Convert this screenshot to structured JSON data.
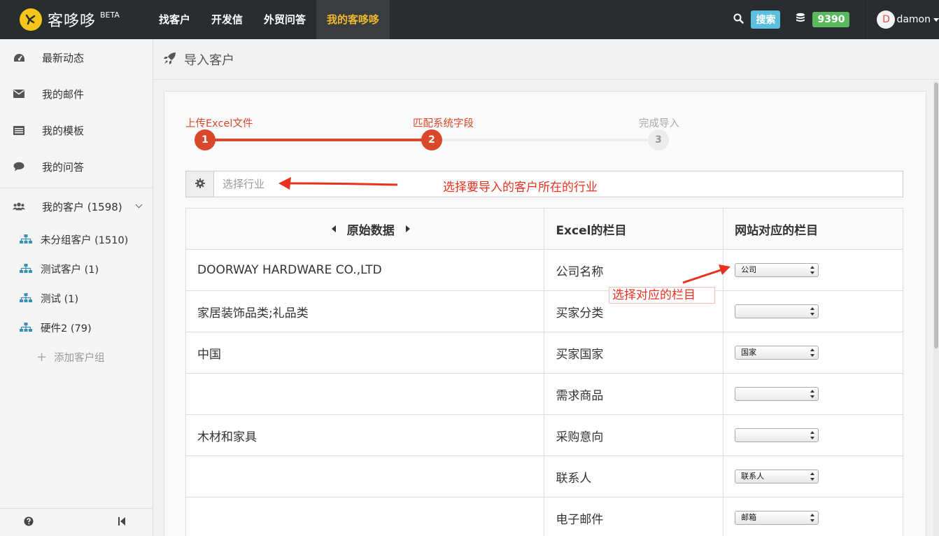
{
  "brand": {
    "name": "客哆哆",
    "beta": "BETA"
  },
  "nav": [
    {
      "label": "找客户"
    },
    {
      "label": "开发信"
    },
    {
      "label": "外贸问答"
    },
    {
      "label": "我的客哆哆",
      "active": true
    }
  ],
  "topright": {
    "search_label": "搜索",
    "credits": "9390",
    "avatar_letter": "D",
    "username": "damon"
  },
  "sidebar": {
    "items": [
      {
        "label": "最新动态",
        "icon": "dashboard-icon"
      },
      {
        "label": "我的邮件",
        "icon": "envelope-icon"
      },
      {
        "label": "我的模板",
        "icon": "list-icon"
      },
      {
        "label": "我的问答",
        "icon": "comment-icon"
      }
    ],
    "customers_label": "我的客户 (1598)",
    "groups": [
      {
        "label": "未分组客户 (1510)"
      },
      {
        "label": "测试客户 (1)"
      },
      {
        "label": "测试 (1)"
      },
      {
        "label": "硬件2 (79)"
      }
    ],
    "add_group": "添加客户组"
  },
  "page": {
    "title": "导入客户"
  },
  "steps": [
    {
      "num": "1",
      "label": "上传Excel文件",
      "state": "done"
    },
    {
      "num": "2",
      "label": "匹配系统字段",
      "state": "active"
    },
    {
      "num": "3",
      "label": "完成导入",
      "state": "pending"
    }
  ],
  "industry": {
    "placeholder": "选择行业"
  },
  "annotations": {
    "industry_note": "选择要导入的客户所在的行业",
    "column_note": "选择对应的栏目"
  },
  "table": {
    "headers": {
      "original": "原始数据",
      "excel": "Excel的栏目",
      "site": "网站对应的栏目"
    },
    "rows": [
      {
        "original": "DOORWAY HARDWARE CO.,LTD",
        "excel": "公司名称",
        "site": "公司"
      },
      {
        "original": "家居装饰品类;礼品类",
        "excel": "买家分类",
        "site": ""
      },
      {
        "original": "中国",
        "excel": "买家国家",
        "site": "国家"
      },
      {
        "original": "",
        "excel": "需求商品",
        "site": ""
      },
      {
        "original": "木材和家具",
        "excel": "采购意向",
        "site": ""
      },
      {
        "original": "",
        "excel": "联系人",
        "site": "联系人"
      },
      {
        "original": "",
        "excel": "电子邮件",
        "site": "邮箱"
      }
    ]
  },
  "colors": {
    "accent": "#d9482b",
    "annotation": "#e8321f",
    "nav_active": "#f0b82d"
  }
}
